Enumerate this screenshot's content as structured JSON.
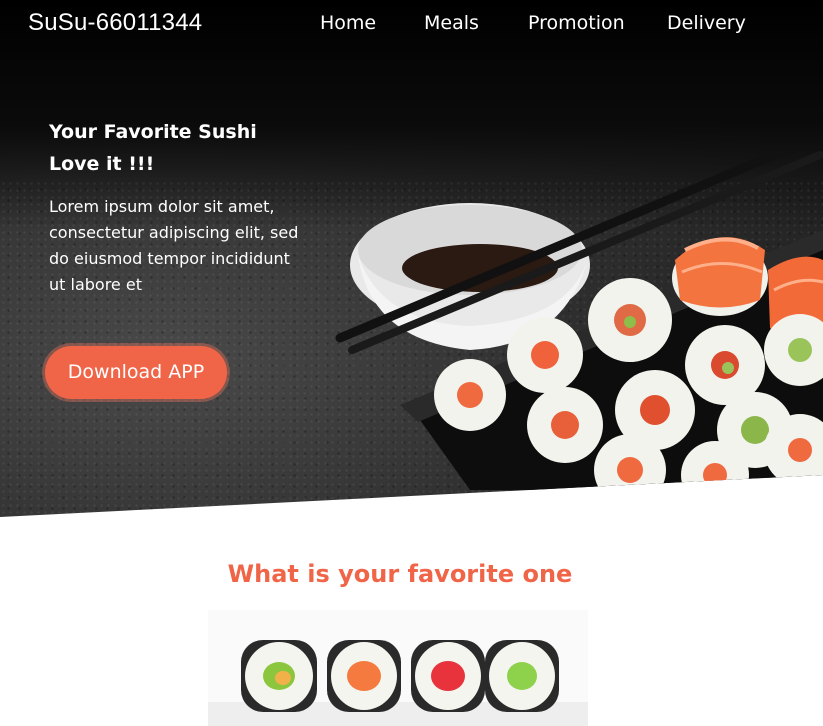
{
  "header": {
    "brand": "SuSu-66011344",
    "nav": [
      "Home",
      "Meals",
      "Promotion",
      "Delivery"
    ]
  },
  "hero": {
    "title": "Your Favorite Sushi Love it !!!",
    "text": "Lorem ipsum dolor sit amet, consectetur adipiscing elit, sed do eiusmod tempor incididunt ut labore et",
    "button": "Download APP"
  },
  "section": {
    "title": "What is your favorite one"
  },
  "colors": {
    "accent": "#f06548",
    "hero_dark": "#1c1c1c",
    "text_light": "#ffffff"
  },
  "images": {
    "hero_photo": "sushi-platter-image",
    "sushi_strip": "sushi-rolls-image"
  }
}
